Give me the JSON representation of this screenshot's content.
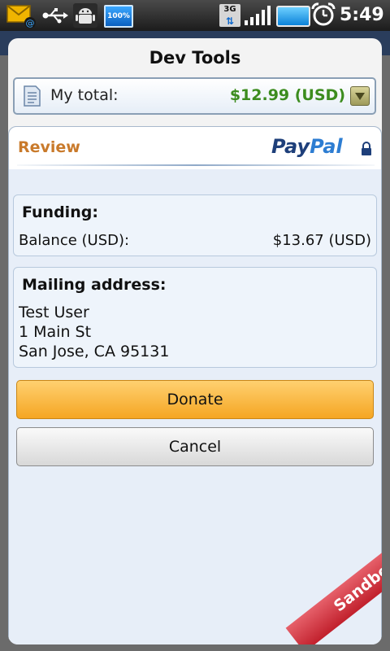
{
  "status_bar": {
    "battery_percent_label": "100%",
    "network_label": "3G",
    "time": "5:49"
  },
  "dialog": {
    "title": "Dev Tools",
    "total": {
      "label": "My total:",
      "amount": "$12.99 (USD)"
    }
  },
  "review": {
    "title": "Review",
    "logo": {
      "pay": "Pay",
      "pal": "Pal"
    }
  },
  "funding": {
    "title": "Funding:",
    "label": "Balance (USD):",
    "value": "$13.67 (USD)"
  },
  "mailing": {
    "title": "Mailing address:",
    "lines": [
      "Test User",
      "1 Main St",
      "San Jose, CA 95131"
    ]
  },
  "buttons": {
    "donate": "Donate",
    "cancel": "Cancel"
  },
  "ribbon": {
    "label": "Sandbox"
  },
  "colors": {
    "amount_green": "#3c8c1e",
    "review_orange": "#c97a2b",
    "donate_yellow": "#f5a623",
    "sandbox_red": "#c1202c"
  }
}
